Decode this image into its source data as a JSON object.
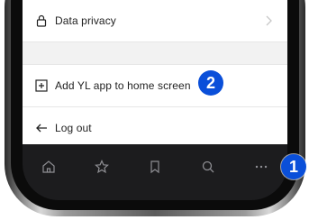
{
  "menu": {
    "items": [
      {
        "label": "Data privacy",
        "icon": "lock-icon",
        "has_chevron": true
      },
      {
        "label": "Add YL app to home screen",
        "icon": "add-square-icon",
        "has_chevron": false
      },
      {
        "label": "Log out",
        "icon": "arrow-left-icon",
        "has_chevron": false
      }
    ]
  },
  "tabbar": {
    "icons": [
      "home-icon",
      "star-icon",
      "bookmark-icon",
      "search-icon",
      "more-icon"
    ]
  },
  "callouts": [
    {
      "number": "2",
      "color": "#0a4fd9"
    },
    {
      "number": "1",
      "color": "#0a4fd9"
    }
  ]
}
